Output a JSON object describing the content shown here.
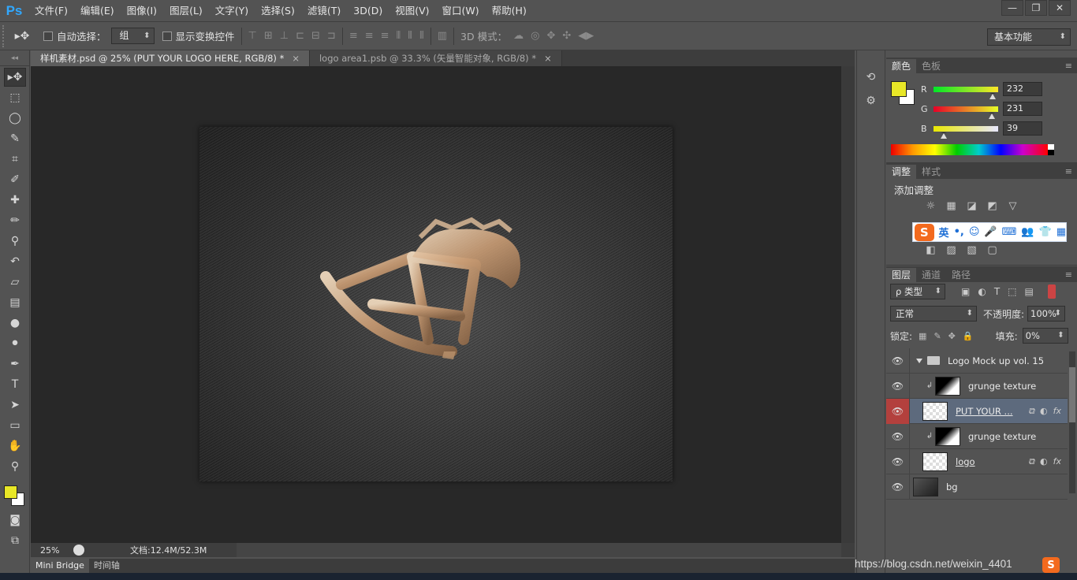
{
  "app": {
    "logo": "Ps"
  },
  "menu": [
    "文件(F)",
    "编辑(E)",
    "图像(I)",
    "图层(L)",
    "文字(Y)",
    "选择(S)",
    "滤镜(T)",
    "3D(D)",
    "视图(V)",
    "窗口(W)",
    "帮助(H)"
  ],
  "window_buttons": {
    "minimize": "—",
    "restore": "❐",
    "close": "✕"
  },
  "options": {
    "auto_select_label": "自动选择：",
    "auto_select_value": "组",
    "show_transform_label": "显示变换控件",
    "mode_3d_label": "3D 模式：",
    "workspace": "基本功能"
  },
  "tabs": [
    {
      "label": "样机素材.psd @ 25% (PUT YOUR LOGO HERE, RGB/8) *",
      "close": "×"
    },
    {
      "label": "logo area1.psb @ 33.3% (矢量智能对象, RGB/8) *",
      "close": "×"
    }
  ],
  "status": {
    "zoom": "25%",
    "doc_info": "文档:12.4M/52.3M"
  },
  "bottom_tabs": [
    "Mini Bridge",
    "时间轴"
  ],
  "colors": {
    "foreground": "#e8e727",
    "background": "#ffffff",
    "accent_selected_layer": "#5d6a7d"
  },
  "color_panel": {
    "tabs": [
      "颜色",
      "色板"
    ],
    "channels": [
      {
        "label": "R",
        "value": "232",
        "fraction": 0.91
      },
      {
        "label": "G",
        "value": "231",
        "fraction": 0.906
      },
      {
        "label": "B",
        "value": "39",
        "fraction": 0.153
      }
    ]
  },
  "adjust_panel": {
    "tabs": [
      "调整",
      "样式"
    ],
    "title": "添加调整"
  },
  "ime": {
    "logo": "S",
    "lang": "英",
    "punct": "•,",
    "emoji": "☺",
    "mic": "🎤",
    "keyboard": "⌨",
    "users": "👥",
    "shirt": "👕",
    "grid": "▦"
  },
  "layers_panel": {
    "tabs": [
      "图层",
      "通道",
      "路径"
    ],
    "filter_label": "ρ 类型",
    "blend_mode": "正常",
    "opacity_label": "不透明度:",
    "opacity_value": "100%",
    "lock_label": "锁定:",
    "fill_label": "填充:",
    "fill_value": "0%",
    "layers": [
      {
        "name": "Logo Mock up vol. 15"
      },
      {
        "name": "grunge texture"
      },
      {
        "name": "PUT YOUR ..."
      },
      {
        "name": "grunge texture"
      },
      {
        "name": "logo"
      },
      {
        "name": "bg"
      }
    ]
  },
  "watermark": "https://blog.csdn.net/weixin_4401"
}
